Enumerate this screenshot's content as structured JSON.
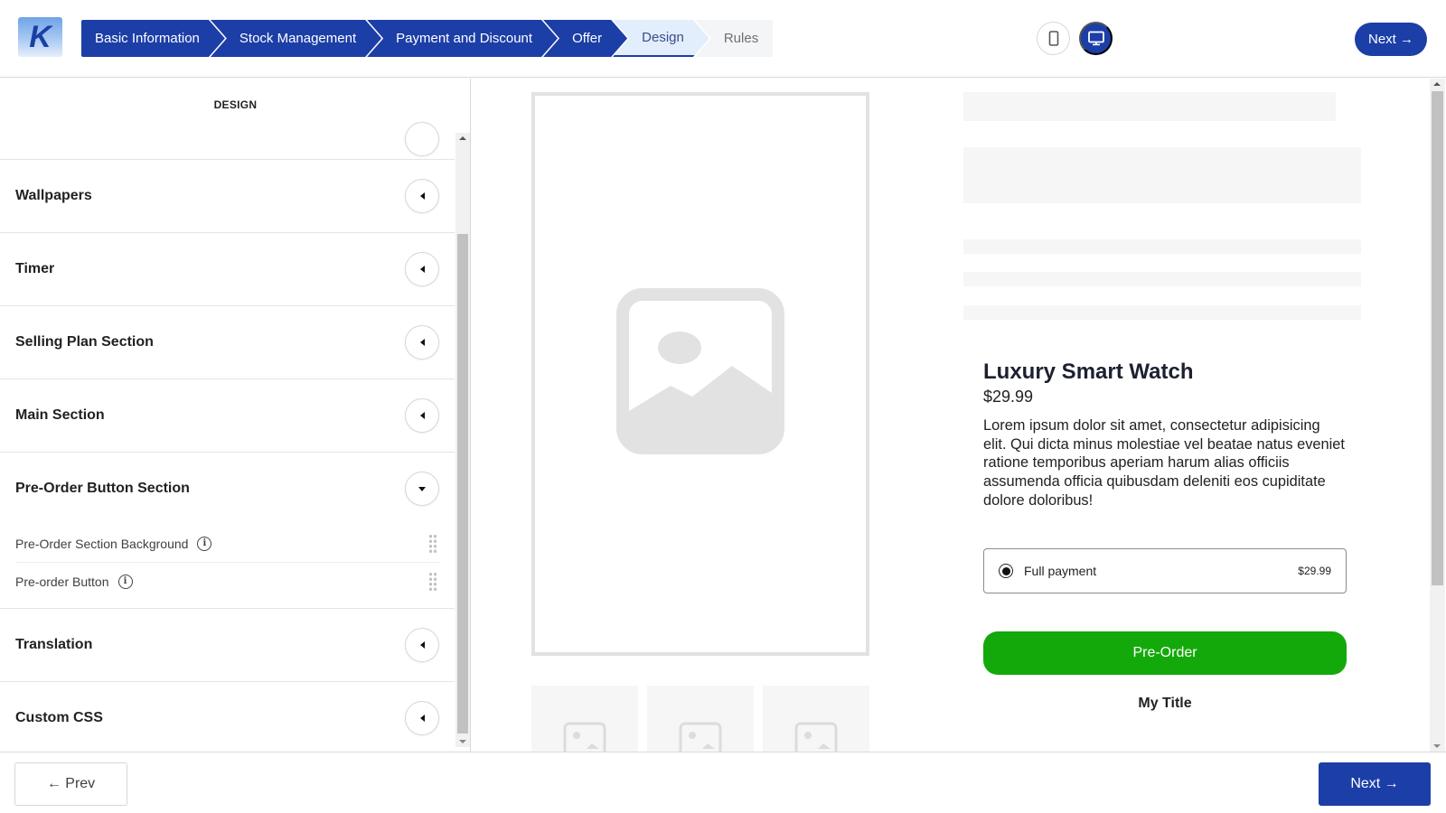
{
  "header": {
    "logo_letter": "K",
    "steps": [
      {
        "label": "Basic Information",
        "state": "done"
      },
      {
        "label": "Stock Management",
        "state": "done"
      },
      {
        "label": "Payment and Discount",
        "state": "done"
      },
      {
        "label": "Offer",
        "state": "done"
      },
      {
        "label": "Design",
        "state": "active"
      },
      {
        "label": "Rules",
        "state": "todo"
      }
    ],
    "device_toggle": {
      "options": [
        "mobile",
        "desktop"
      ],
      "selected": "desktop"
    },
    "next_label": "Next →"
  },
  "left_panel": {
    "title": "DESIGN",
    "sections": [
      {
        "label": "Wallpapers",
        "expanded": false
      },
      {
        "label": "Timer",
        "expanded": false
      },
      {
        "label": "Selling Plan Section",
        "expanded": false
      },
      {
        "label": "Main Section",
        "expanded": false
      },
      {
        "label": "Pre-Order Button Section",
        "expanded": true,
        "items": [
          {
            "label": "Pre-Order Section Background"
          },
          {
            "label": "Pre-order Button"
          }
        ]
      },
      {
        "label": "Translation",
        "expanded": false
      },
      {
        "label": "Custom CSS",
        "expanded": false
      }
    ]
  },
  "preview": {
    "product": {
      "title": "Luxury Smart Watch",
      "price": "$29.99",
      "description": "Lorem ipsum dolor sit amet, consectetur adipisicing elit. Qui dicta minus molestiae vel beatae natus eveniet ratione temporibus aperiam harum alias officiis assumenda officia quibusdam deleniti eos cupiditate dolore doloribus!"
    },
    "payment_option": {
      "label": "Full payment",
      "price": "$29.99",
      "selected": true
    },
    "preorder_button_label": "Pre-Order",
    "preorder_button_color": "#14a90b",
    "my_title": "My Title"
  },
  "footer": {
    "prev_label": "← Prev",
    "next_label": "Next →"
  },
  "colors": {
    "brand": "#1c3ea7",
    "active_step_bg": "#e3eefc",
    "preorder_green": "#14a90b"
  }
}
